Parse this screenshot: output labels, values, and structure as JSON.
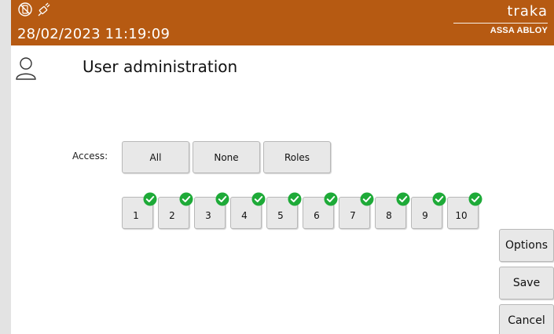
{
  "header": {
    "datetime": "28/02/2023 11:19:09",
    "brand_name": "traka",
    "brand_sub": "ASSA ABLOY",
    "status_icons": [
      "no-phone-icon",
      "no-power-plug-icon"
    ],
    "background_color": "#b65a12"
  },
  "page": {
    "title": "User administration",
    "user_icon": "user-icon"
  },
  "access": {
    "label": "Access:",
    "buttons": [
      "All",
      "None",
      "Roles"
    ]
  },
  "keys": [
    {
      "label": "1",
      "checked": true
    },
    {
      "label": "2",
      "checked": true
    },
    {
      "label": "3",
      "checked": true
    },
    {
      "label": "4",
      "checked": true
    },
    {
      "label": "5",
      "checked": true
    },
    {
      "label": "6",
      "checked": true
    },
    {
      "label": "7",
      "checked": true
    },
    {
      "label": "8",
      "checked": true
    },
    {
      "label": "9",
      "checked": true
    },
    {
      "label": "10",
      "checked": true
    }
  ],
  "check_color": "#1eaa38",
  "side": {
    "options_label": "Options",
    "save_label": "Save",
    "cancel_label": "Cancel"
  }
}
